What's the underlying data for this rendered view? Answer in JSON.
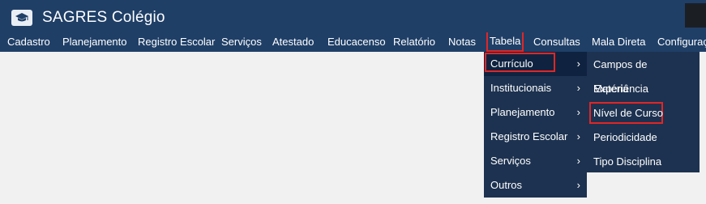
{
  "app": {
    "title": "SAGRES Colégio",
    "logo_icon": "graduation-cap-icon"
  },
  "menubar": {
    "items": [
      {
        "label": "Cadastro"
      },
      {
        "label": "Planejamento"
      },
      {
        "label": "Registro Escolar"
      },
      {
        "label": "Serviços"
      },
      {
        "label": "Atestado"
      },
      {
        "label": "Educacenso"
      },
      {
        "label": "Relatório"
      },
      {
        "label": "Notas"
      },
      {
        "label": "Tabela"
      },
      {
        "label": "Consultas"
      },
      {
        "label": "Mala Direta"
      },
      {
        "label": "Configuraç"
      }
    ]
  },
  "dropdown": {
    "items": [
      {
        "label": "Currículo"
      },
      {
        "label": "Institucionais"
      },
      {
        "label": "Planejamento"
      },
      {
        "label": "Registro Escolar"
      },
      {
        "label": "Serviços"
      },
      {
        "label": "Outros"
      }
    ],
    "chevron": "›"
  },
  "submenu": {
    "items": [
      {
        "label": "Campos de Experiência"
      },
      {
        "label": "Matéria"
      },
      {
        "label": "Nível de Curso"
      },
      {
        "label": "Periodicidade"
      },
      {
        "label": "Tipo Disciplina"
      }
    ]
  },
  "colors": {
    "header": "#1f3f67",
    "menu_panel": "#1d3250",
    "highlight_border": "#e12626",
    "page_background": "#f1f1f1"
  }
}
